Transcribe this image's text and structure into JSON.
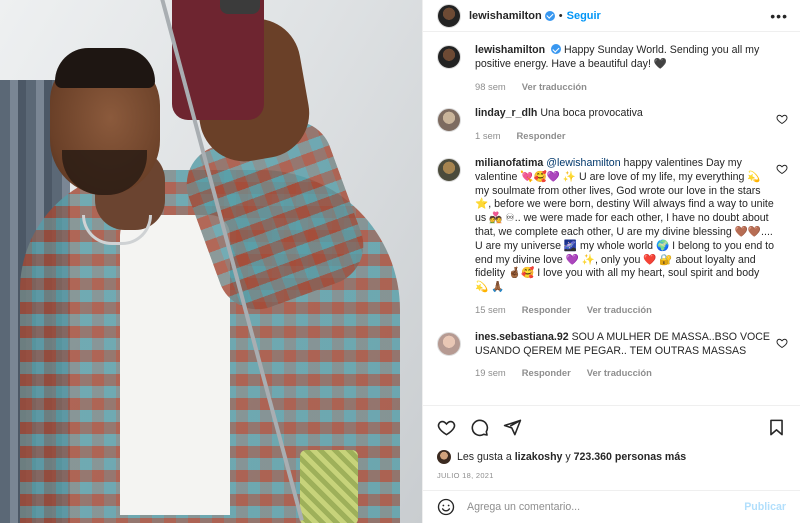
{
  "post": {
    "username": "lewishamilton",
    "follow_label": "Seguir",
    "more_label": "•••"
  },
  "caption": {
    "username": "lewishamilton",
    "text": "Happy Sunday World. Sending you all my positive energy. Have a beautiful day! 🖤",
    "time": "98 sem",
    "translate": "Ver traducción"
  },
  "comments": [
    {
      "username": "linday_r_dlh",
      "text": "Una boca provocativa",
      "time": "1 sem",
      "reply": "Responder",
      "translate": ""
    },
    {
      "username": "milianofatima",
      "mention": "@lewishamilton",
      "text": "happy valentines Day my valentine 💘🥰💜 ✨ U are love of my life, my everything 💫 my soulmate from other lives, God wrote our love in the stars ⭐, before we were born, destiny Will always find a way to unite us 💑 ♾.. we were made for each other, I have no doubt about that, we complete each other, U are my divine blessing 🤎🤎.... U are my universe 🌌 my whole world 🌍 I belong to you end to end my divine love 💜 ✨, only you ❤️ 🔐 about loyalty and fidelity 🤞🏾🥰 I love you with all my heart, soul spirit and body 💫 🙏🏾",
      "time": "15 sem",
      "reply": "Responder",
      "translate": "Ver traducción"
    },
    {
      "username": "ines.sebastiana.92",
      "text": "SOU A MULHER DE MASSA..BSO VOCE USANDO QEREM ME PEGAR.. TEM OUTRAS MASSAS",
      "time": "19 sem",
      "reply": "Responder",
      "translate": "Ver traducción"
    }
  ],
  "likes": {
    "prefix": "Les gusta a",
    "user": "lizakoshy",
    "connector": "y",
    "count": "723.360 personas más"
  },
  "date": "JULIO 18, 2021",
  "add_comment": {
    "placeholder": "Agrega un comentario...",
    "publish": "Publicar"
  },
  "icons": {
    "like": "heart-icon",
    "comment": "comment-icon",
    "share": "send-icon",
    "save": "bookmark-icon",
    "emoji": "emoji-icon"
  },
  "colors": {
    "follow": "#0095f6",
    "verified": "#3897f0",
    "publish_disabled": "#b2dffc",
    "meta": "#8e8e8e"
  }
}
